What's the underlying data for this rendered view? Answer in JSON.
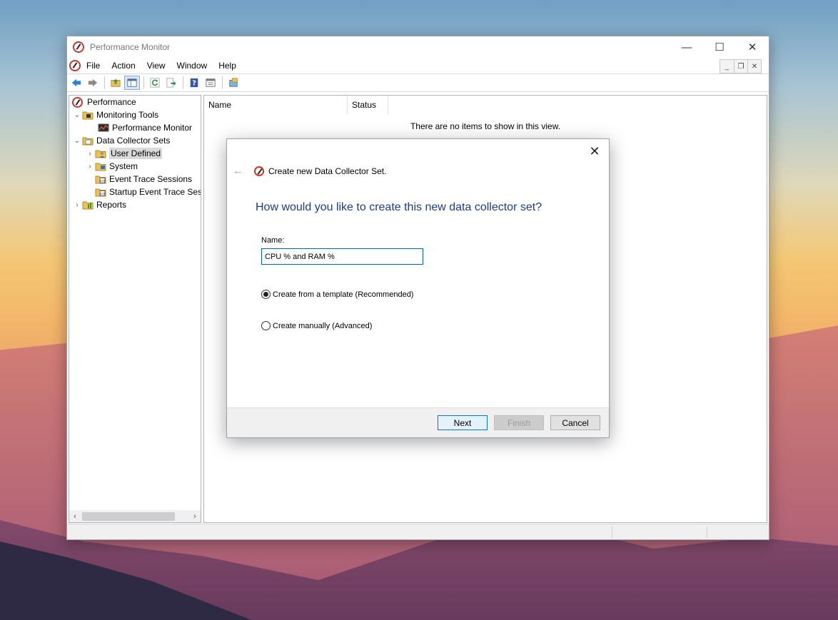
{
  "window": {
    "title": "Performance Monitor",
    "controls": {
      "minimize": "—",
      "maximize": "☐",
      "close": "✕"
    }
  },
  "menu": {
    "items": [
      "File",
      "Action",
      "View",
      "Window",
      "Help"
    ],
    "mdi": {
      "minimize": "_",
      "restore": "❐",
      "close": "✕"
    }
  },
  "toolbar": {
    "icons": [
      "back-arrow-icon",
      "forward-arrow-icon",
      "up-folder-icon",
      "show-hide-tree-icon",
      "refresh-icon",
      "export-list-icon",
      "help-icon",
      "properties-icon",
      "new-window-icon"
    ]
  },
  "tree": {
    "items": [
      {
        "label": "Performance",
        "chevron": "",
        "icon": "perfmon-icon"
      },
      {
        "label": "Monitoring Tools",
        "chevron": "⌄",
        "icon": "folder-icon"
      },
      {
        "label": "Performance Monitor",
        "chevron": "",
        "icon": "monitor-graph-icon"
      },
      {
        "label": "Data Collector Sets",
        "chevron": "⌄",
        "icon": "folder-icon"
      },
      {
        "label": "User Defined",
        "chevron": "›",
        "icon": "user-folder-icon"
      },
      {
        "label": "System",
        "chevron": "›",
        "icon": "system-folder-icon"
      },
      {
        "label": "Event Trace Sessions",
        "chevron": "",
        "icon": "trace-folder-icon"
      },
      {
        "label": "Startup Event Trace Sess",
        "chevron": "",
        "icon": "trace-folder-icon"
      },
      {
        "label": "Reports",
        "chevron": "›",
        "icon": "reports-folder-icon"
      }
    ],
    "scroll": {
      "left": "‹",
      "right": "›"
    }
  },
  "list": {
    "columns": [
      "Name",
      "Status"
    ],
    "empty_message": "There are no items to show in this view."
  },
  "dialog": {
    "close": "✕",
    "back": "←",
    "title": "Create new Data Collector Set.",
    "question": "How would you like to create this new data collector set?",
    "name_label": "Name:",
    "name_value": "CPU % and RAM %",
    "options": [
      {
        "label": "Create from a template (Recommended)",
        "checked": true
      },
      {
        "label": "Create manually (Advanced)",
        "checked": false
      }
    ],
    "buttons": {
      "next": "Next",
      "finish": "Finish",
      "cancel": "Cancel"
    }
  },
  "colors": {
    "accent": "#0078d7",
    "question_text": "#1f3a8a",
    "selection": "#d9d9d9"
  }
}
